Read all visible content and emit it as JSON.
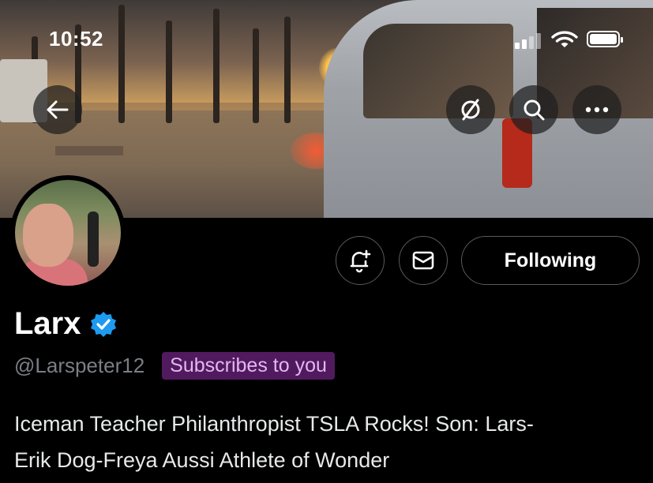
{
  "status_bar": {
    "time": "10:52"
  },
  "header": {
    "back_icon": "arrow-left-icon",
    "grok_icon": "slashed-circle-icon",
    "search_icon": "search-icon",
    "more_icon": "more-horizontal-icon"
  },
  "profile": {
    "name": "Larx",
    "verified": true,
    "handle": "@Larspeter12",
    "subscribes_badge": "Subscribes to you",
    "follow_label": "Following",
    "bio_line1": "Iceman Teacher Philanthropist TSLA Rocks! Son: Lars-",
    "bio_line2": "Erik Dog-Freya Aussi Athlete of Wonder"
  },
  "colors": {
    "background": "#000000",
    "verified_blue": "#1d9bf0",
    "badge_bg": "#521a5e",
    "badge_text": "#e2b8f0",
    "handle_gray": "#7a7f85"
  }
}
